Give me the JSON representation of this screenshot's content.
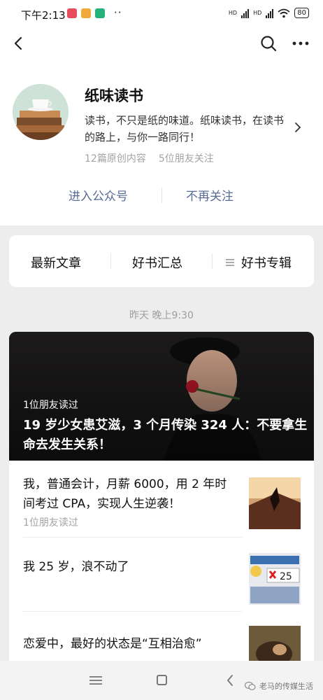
{
  "status_bar": {
    "time": "下午2:13",
    "network_1": "HD",
    "network_2": "HD",
    "battery": "80",
    "app_icon_colors": [
      "#e84b5a",
      "#f2a93b",
      "#24b27a"
    ],
    "more_indicator": "··"
  },
  "nav": {
    "back_icon": "back-chevron-icon",
    "search_icon": "search-icon",
    "more_icon": "more-dots-icon"
  },
  "account": {
    "name": "纸味读书",
    "description": "读书，不只是纸的味道。纸味读书，在读书的路上，与你一路同行！",
    "original_count": "12篇原创内容",
    "friends_following": "5位朋友关注",
    "enter_label": "进入公众号",
    "unfollow_label": "不再关注"
  },
  "menu": {
    "items": [
      "最新文章",
      "好书汇总",
      "好书专辑"
    ]
  },
  "feed": {
    "date": "昨天 晚上9:30",
    "hero": {
      "friend_read": "1位朋友读过",
      "title": "19 岁少女患艾滋，3 个月传染 324 人：不要拿生命去发生关系！"
    },
    "articles": [
      {
        "title": "我，普通会计，月薪 6000，用 2 年时间考过 CPA，实现人生逆袭！",
        "meta": "1位朋友读过"
      },
      {
        "title": "我 25 岁，浪不动了",
        "meta": ""
      },
      {
        "title": "恋爱中，最好的状态是“互相治愈”",
        "meta": ""
      }
    ]
  },
  "bottom_bar": {
    "watermark": "老马的传媒生活"
  },
  "colors": {
    "link_blue": "#576b95",
    "page_bg": "#ededed",
    "muted_text": "#a3a3a3"
  }
}
